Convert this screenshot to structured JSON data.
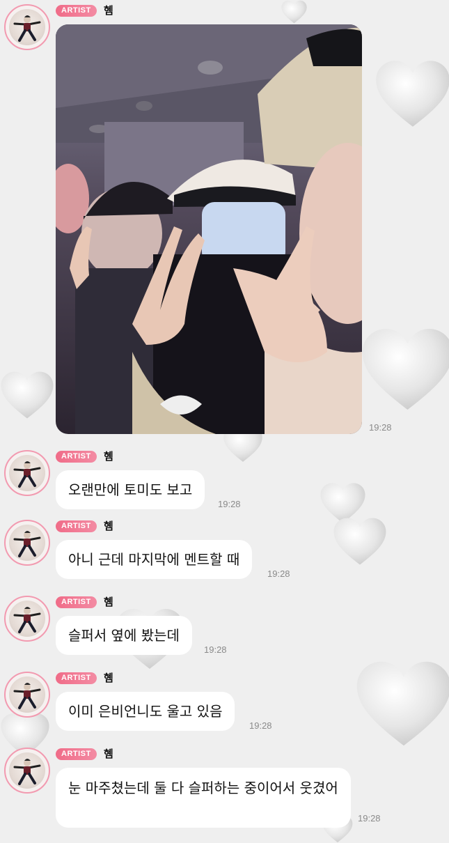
{
  "theme": {
    "badge_color": "#f06c88",
    "avatar_ring": "#f29ab0",
    "background": "#efefef",
    "bubble": "#ffffff"
  },
  "photo_message": {
    "badge": "ARTIST",
    "author": "혬",
    "time": "19:28"
  },
  "messages": [
    {
      "badge": "ARTIST",
      "author": "혬",
      "text": "오랜만에 토미도 보고",
      "time": "19:28"
    },
    {
      "badge": "ARTIST",
      "author": "혬",
      "text": "아니 근데 마지막에 멘트할 때",
      "time": "19:28"
    },
    {
      "badge": "ARTIST",
      "author": "혬",
      "text": "슬퍼서 옆에 봤는데",
      "time": "19:28"
    },
    {
      "badge": "ARTIST",
      "author": "혬",
      "text": "이미 은비언니도 울고 있음",
      "time": "19:28"
    },
    {
      "badge": "ARTIST",
      "author": "혬",
      "text": "눈 마주쳤는데 둘 다 슬퍼하는 중이어서 웃겼어",
      "time": "19:28"
    }
  ]
}
